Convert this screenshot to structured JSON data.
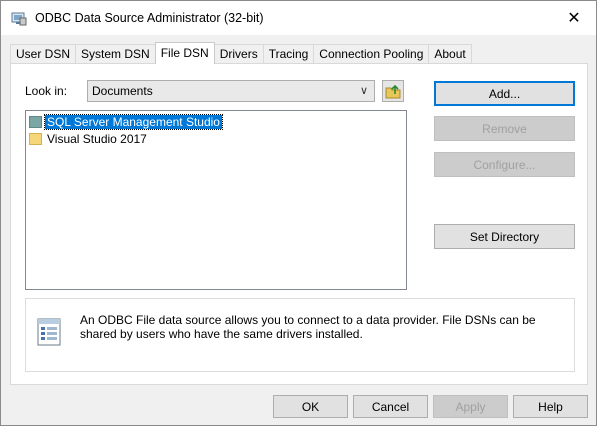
{
  "window": {
    "title": "ODBC Data Source Administrator (32-bit)"
  },
  "tabs": [
    {
      "label": "User DSN"
    },
    {
      "label": "System DSN"
    },
    {
      "label": "File DSN"
    },
    {
      "label": "Drivers"
    },
    {
      "label": "Tracing"
    },
    {
      "label": "Connection Pooling"
    },
    {
      "label": "About"
    }
  ],
  "active_tab": "File DSN",
  "look_in": {
    "label": "Look in:",
    "value": "Documents"
  },
  "file_list": [
    {
      "name": "SQL Server Management Studio",
      "selected": true
    },
    {
      "name": "Visual Studio 2017",
      "selected": false
    }
  ],
  "side_buttons": {
    "add": "Add...",
    "remove": "Remove",
    "configure": "Configure...",
    "set_directory": "Set Directory"
  },
  "info_text": "An ODBC File data source allows you to connect to a data provider.  File DSNs can be shared by users who have the same drivers installed.",
  "bottom_buttons": {
    "ok": "OK",
    "cancel": "Cancel",
    "apply": "Apply",
    "help": "Help"
  },
  "icons": {
    "app": "odbc-admin-icon",
    "close": "close-icon",
    "dropdown": "chevron-down-icon",
    "up_folder": "up-folder-icon",
    "folder": "folder-icon",
    "info": "data-source-icon"
  },
  "colors": {
    "selection": "#0078d7",
    "folder": "#f5d77a",
    "window_bg": "#f0f0f0"
  }
}
